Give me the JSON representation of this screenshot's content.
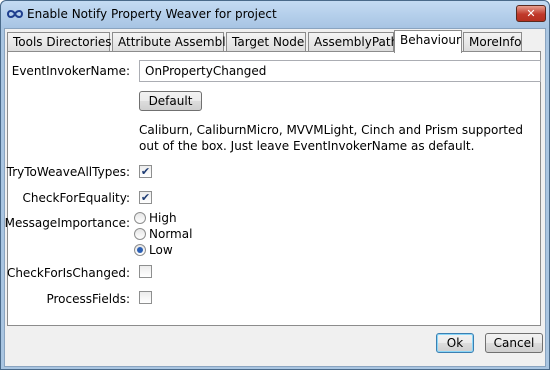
{
  "window": {
    "title": "Enable Notify Property Weaver for project",
    "close_label": "✕",
    "app_icon": "infinity-icon"
  },
  "tabs": [
    {
      "label": "Tools Directories",
      "active": false
    },
    {
      "label": "Attribute Assembly",
      "active": false
    },
    {
      "label": "Target Node",
      "active": false
    },
    {
      "label": "AssemblyPath",
      "active": false
    },
    {
      "label": "Behaviour",
      "active": true
    },
    {
      "label": "MoreInfo",
      "active": false
    }
  ],
  "behaviour": {
    "event_invoker_label": "EventInvokerName:",
    "event_invoker_value": "OnPropertyChanged",
    "default_button": "Default",
    "info_text": "Caliburn, CaliburnMicro, MVVMLight, Cinch and Prism supported out of the box. Just leave EventInvokerName as default.",
    "try_weave_label": "TryToWeaveAllTypes:",
    "try_weave_checked": true,
    "check_equality_label": "CheckForEquality:",
    "check_equality_checked": true,
    "message_importance_label": "MessageImportance:",
    "importance_options": [
      "High",
      "Normal",
      "Low"
    ],
    "importance_selected": "Low",
    "check_changed_label": "CheckForIsChanged:",
    "check_changed_checked": false,
    "process_fields_label": "ProcessFields:",
    "process_fields_checked": false
  },
  "footer": {
    "ok_label": "Ok",
    "cancel_label": "Cancel"
  },
  "colors": {
    "titlebar": "#a7c4e3",
    "close_button": "#c0392b",
    "check_mark": "#1d3b73"
  }
}
